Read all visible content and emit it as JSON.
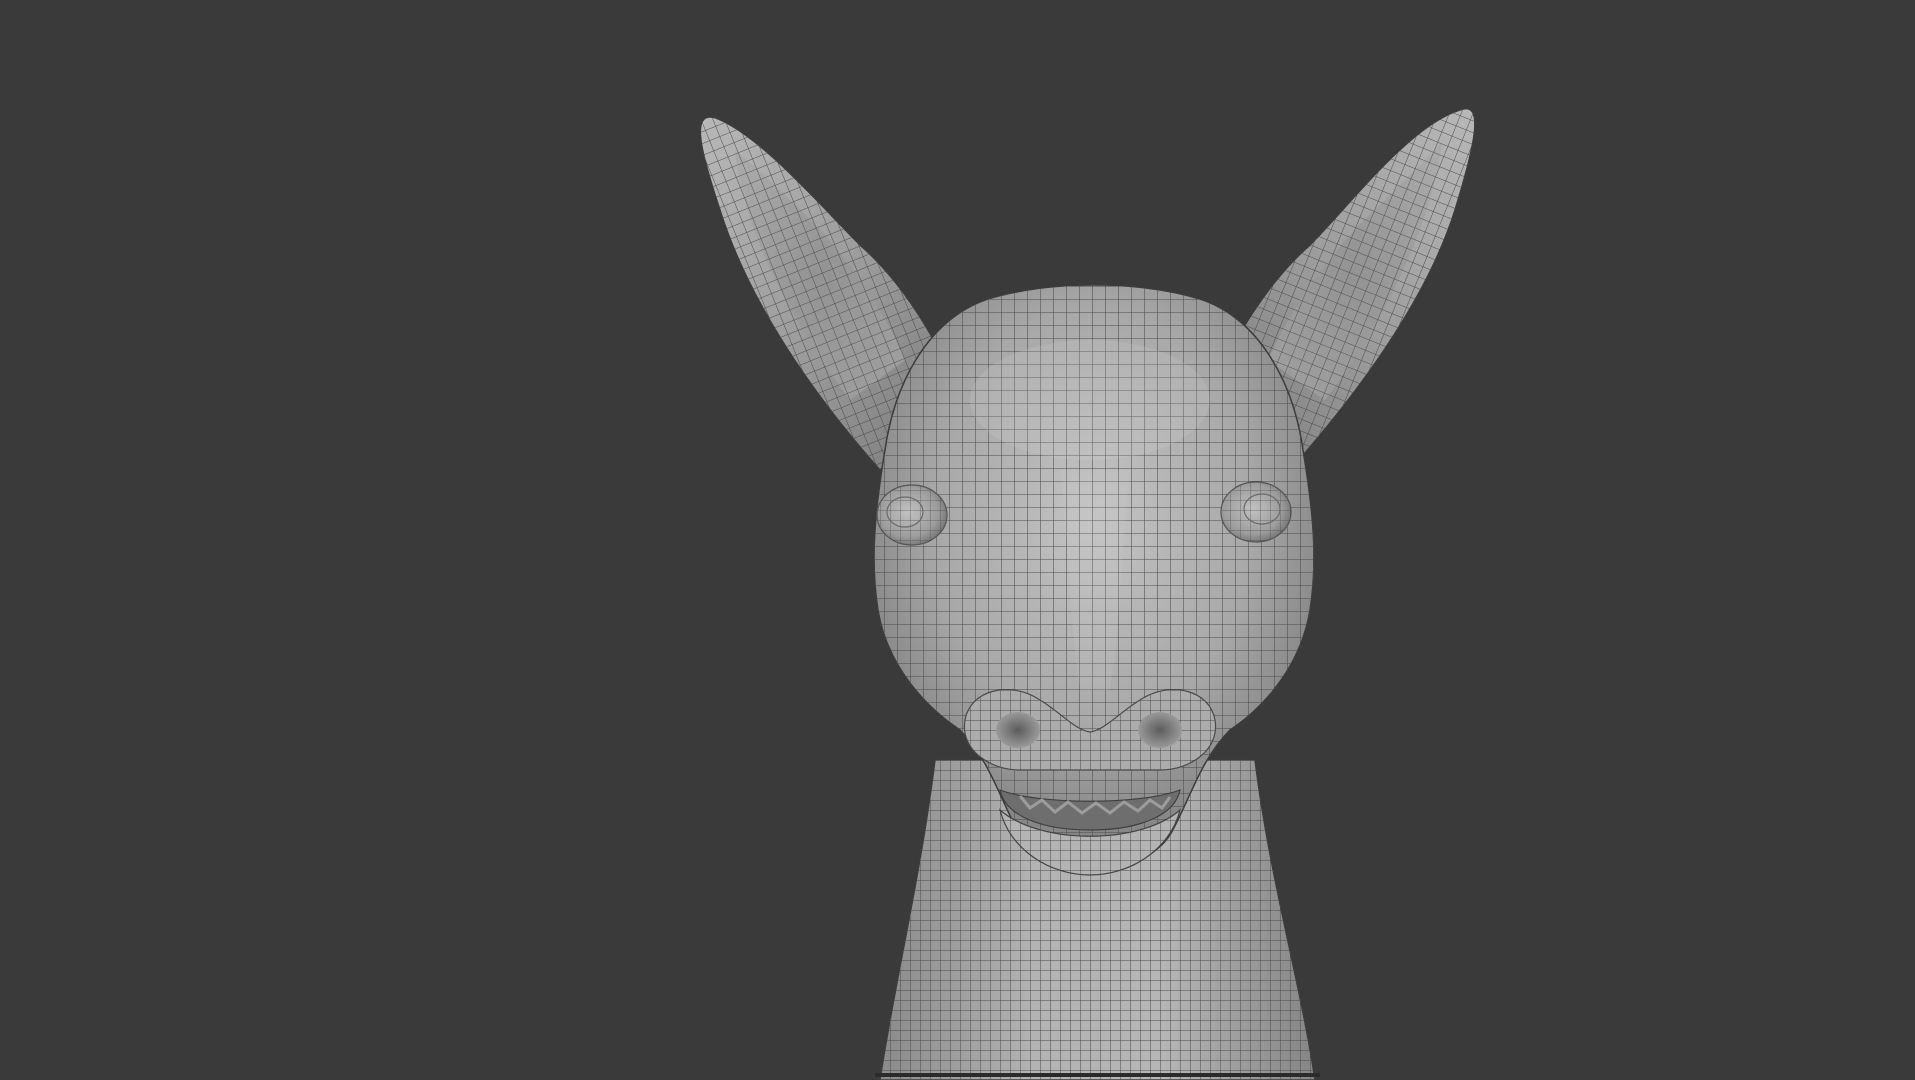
{
  "viewport": {
    "background": "#3a3a3a",
    "subject": "deer-head-wireframe-model",
    "shading": "solid-with-wireframe-overlay",
    "model_color": "#a9a9a9",
    "wire_color": "#4a4a4a"
  }
}
